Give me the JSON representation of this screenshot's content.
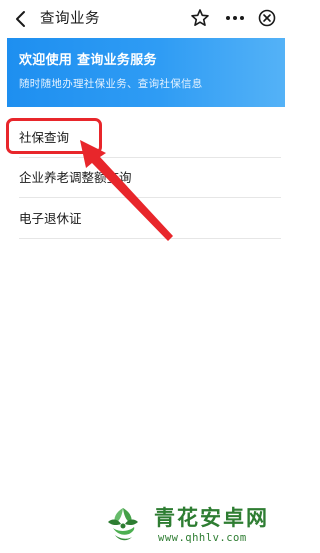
{
  "nav": {
    "title": "查询业务",
    "back_icon": "chevron-left-icon",
    "star_icon": "star-outline-icon",
    "more_icon": "more-dots-icon",
    "close_icon": "close-circle-icon"
  },
  "banner": {
    "title": "欢迎使用 查询业务服务",
    "subtitle": "随时随地办理社保业务、查询社保信息",
    "color_start": "#1e8ff0",
    "color_end": "#54b2f7"
  },
  "list": {
    "items": [
      {
        "label": "社保查询"
      },
      {
        "label": "企业养老调整额查询"
      },
      {
        "label": "电子退休证"
      }
    ]
  },
  "annotation": {
    "color": "#e8262b"
  },
  "watermark": {
    "name": "青花安卓网",
    "url": "www.qhhlv.com",
    "color": "#2e7d32"
  }
}
